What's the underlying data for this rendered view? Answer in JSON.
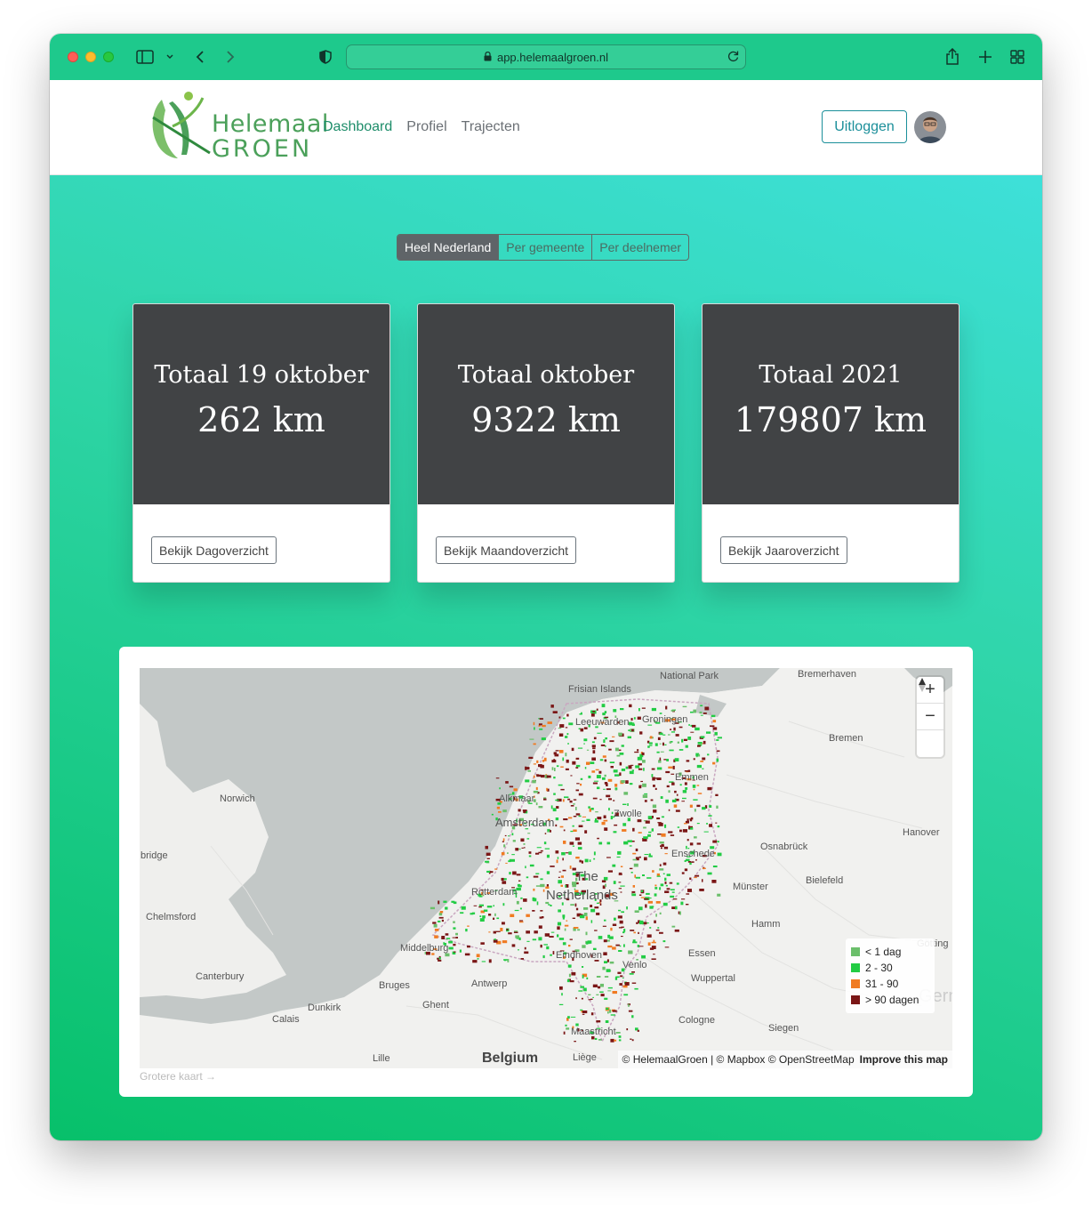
{
  "browser": {
    "url": "app.helemaalgroen.nl"
  },
  "brand": {
    "line1": "Helemaal",
    "line2": "GROEN",
    "accent": "#1ec98c",
    "logo_green": "#4ba05a"
  },
  "nav": {
    "items": [
      "Dashboard",
      "Profiel",
      "Trajecten"
    ],
    "active": "Dashboard",
    "logout_label": "Uitloggen"
  },
  "scope_tabs": {
    "items": [
      "Heel Nederland",
      "Per gemeente",
      "Per deelnemer"
    ],
    "active": "Heel Nederland"
  },
  "cards": [
    {
      "title": "Totaal 19 oktober",
      "value": "262 km",
      "button": "Bekijk Dagoverzicht"
    },
    {
      "title": "Totaal oktober",
      "value": "9322 km",
      "button": "Bekijk Maandoverzicht"
    },
    {
      "title": "Totaal 2021",
      "value": "179807 km",
      "button": "Bekijk Jaaroverzicht"
    }
  ],
  "map": {
    "places": [
      "Frisian Islands",
      "National Park",
      "Bremerhaven",
      "Leeuwarden",
      "Groningen",
      "Bremen",
      "Emmen",
      "Alkmaar",
      "Norwich",
      "Amsterdam",
      "Zwolle",
      "Hanover",
      "Enschede",
      "Osnabrück",
      "bridge",
      "The",
      "Netherlands",
      "Rotterdam",
      "Bielefeld",
      "Münster",
      "Chelmsford",
      "Hamm",
      "Middelburg",
      "Eindhoven",
      "Essen",
      "Venlo",
      "Canterbury",
      "Bruges",
      "Antwerp",
      "Wuppertal",
      "Dunkirk",
      "Ghent",
      "Calais",
      "Cologne",
      "Siegen",
      "Maastricht",
      "Belgium",
      "Lille",
      "Liège",
      "Götting",
      "Germ"
    ],
    "legend": [
      {
        "label": "< 1 dag",
        "color": "#6bbf6b"
      },
      {
        "label": "2 - 30",
        "color": "#22cc44"
      },
      {
        "label": "31 - 90",
        "color": "#f07b22"
      },
      {
        "label": "> 90 dagen",
        "color": "#7a1616"
      }
    ],
    "zoom_in": "+",
    "zoom_out": "−",
    "attribution": "© HelemaalGroen | © Mapbox © OpenStreetMap",
    "improve": "Improve this map",
    "bigger_map": "Grotere kaart →"
  }
}
